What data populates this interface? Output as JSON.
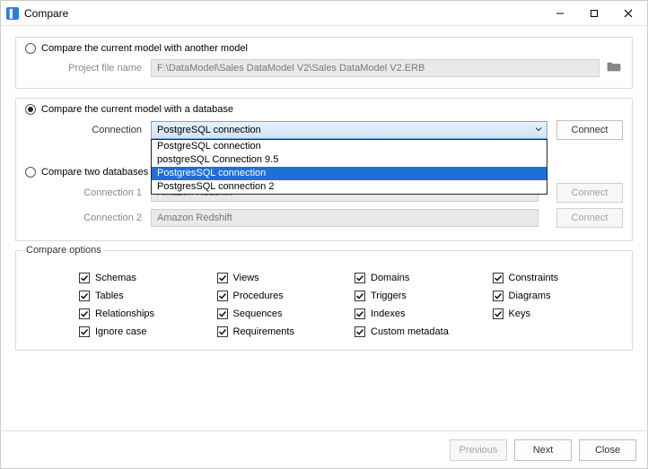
{
  "window": {
    "title": "Compare"
  },
  "sections": {
    "model": {
      "radio_label": "Compare the current model with another model",
      "selected": false,
      "file_label": "Project file name",
      "file_value": "F:\\DataModel\\Sales DataModel V2\\Sales DataModel V2.ERB"
    },
    "database": {
      "radio_label": "Compare the current model with a database",
      "selected": true,
      "conn_label": "Connection",
      "conn_value": "PostgreSQL connection",
      "connect_btn": "Connect",
      "dropdown_items": [
        "PostgreSQL connection",
        "postgreSQL Connection 9.5",
        "PostgresSQL connection",
        "PostgresSQL connection 2"
      ],
      "dropdown_highlight_index": 2
    },
    "twodb": {
      "radio_label": "Compare two databases",
      "selected": false,
      "conn1_label": "Connection 1",
      "conn1_value": "Amazon Redshift",
      "conn2_label": "Connection 2",
      "conn2_value": "Amazon Redshift",
      "connect_btn": "Connect"
    }
  },
  "options": {
    "title": "Compare options",
    "items": [
      {
        "label": "Schemas",
        "checked": true
      },
      {
        "label": "Views",
        "checked": true
      },
      {
        "label": "Domains",
        "checked": true
      },
      {
        "label": "Constraints",
        "checked": true
      },
      {
        "label": "Tables",
        "checked": true
      },
      {
        "label": "Procedures",
        "checked": true
      },
      {
        "label": "Triggers",
        "checked": true
      },
      {
        "label": "Diagrams",
        "checked": true
      },
      {
        "label": "Relationships",
        "checked": true
      },
      {
        "label": "Sequences",
        "checked": true
      },
      {
        "label": "Indexes",
        "checked": true
      },
      {
        "label": "Keys",
        "checked": true
      },
      {
        "label": "Ignore case",
        "checked": true
      },
      {
        "label": "Requirements",
        "checked": true
      },
      {
        "label": "Custom metadata",
        "checked": true
      }
    ]
  },
  "footer": {
    "previous": "Previous",
    "next": "Next",
    "close": "Close"
  }
}
